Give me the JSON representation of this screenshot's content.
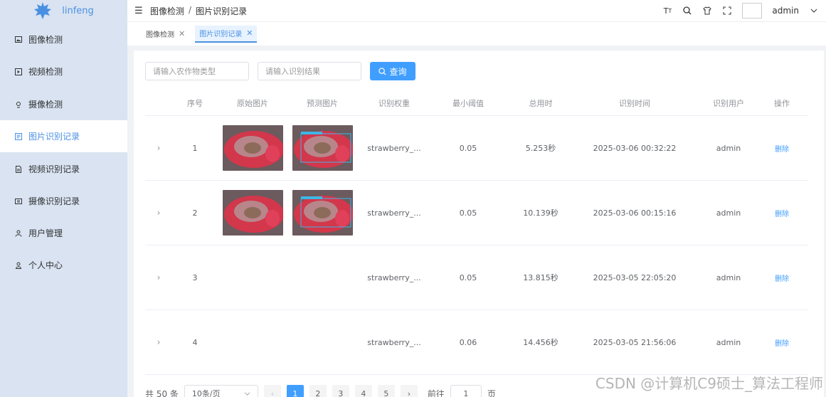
{
  "sidebar": {
    "logo_text": "linfeng",
    "items": [
      {
        "label": "图像检测",
        "icon": "image-icon",
        "active": false
      },
      {
        "label": "视频检测",
        "icon": "video-icon",
        "active": false
      },
      {
        "label": "摄像检测",
        "icon": "camera-icon",
        "active": false
      },
      {
        "label": "图片识别记录",
        "icon": "record-icon",
        "active": true
      },
      {
        "label": "视频识别记录",
        "icon": "document-icon",
        "active": false
      },
      {
        "label": "摄像识别记录",
        "icon": "monitor-icon",
        "active": false
      },
      {
        "label": "用户管理",
        "icon": "users-icon",
        "active": false
      },
      {
        "label": "个人中心",
        "icon": "user-icon",
        "active": false
      }
    ]
  },
  "header": {
    "breadcrumb": [
      "图像检测",
      "图片识别记录"
    ],
    "breadcrumb_sep": "/",
    "user_name": "admin"
  },
  "tabs": [
    {
      "label": "图像检测",
      "active": false
    },
    {
      "label": "图片识别记录",
      "active": true
    }
  ],
  "filters": {
    "crop_placeholder": "请输入农作物类型",
    "result_placeholder": "请输入识别结果",
    "search_label": "查询"
  },
  "table": {
    "headers": [
      "序号",
      "原始图片",
      "预测图片",
      "识别权重",
      "最小阈值",
      "总用时",
      "识别时间",
      "识别用户",
      "操作"
    ],
    "rows": [
      {
        "idx": "1",
        "has_images": true,
        "weight": "strawberry_...",
        "threshold": "0.05",
        "time": "5.253秒",
        "date": "2025-03-06 00:32:22",
        "user": "admin",
        "action": "删除"
      },
      {
        "idx": "2",
        "has_images": true,
        "weight": "strawberry_...",
        "threshold": "0.05",
        "time": "10.139秒",
        "date": "2025-03-06 00:15:16",
        "user": "admin",
        "action": "删除"
      },
      {
        "idx": "3",
        "has_images": false,
        "weight": "strawberry_...",
        "threshold": "0.05",
        "time": "13.815秒",
        "date": "2025-03-05 22:05:20",
        "user": "admin",
        "action": "删除"
      },
      {
        "idx": "4",
        "has_images": false,
        "weight": "strawberry_...",
        "threshold": "0.06",
        "time": "14.456秒",
        "date": "2025-03-05 21:56:06",
        "user": "admin",
        "action": "删除"
      }
    ]
  },
  "pagination": {
    "total_label": "共 50 条",
    "page_size": "10条/页",
    "pages": [
      "1",
      "2",
      "3",
      "4",
      "5"
    ],
    "current_page": "1",
    "goto_label": "前往",
    "goto_value": "1",
    "page_suffix": "页"
  },
  "watermark": "CSDN @计算机C9硕士_算法工程师",
  "colors": {
    "primary": "#409eff",
    "sidebar_bg": "#d9e3f1",
    "active_text": "#4a90e2"
  }
}
